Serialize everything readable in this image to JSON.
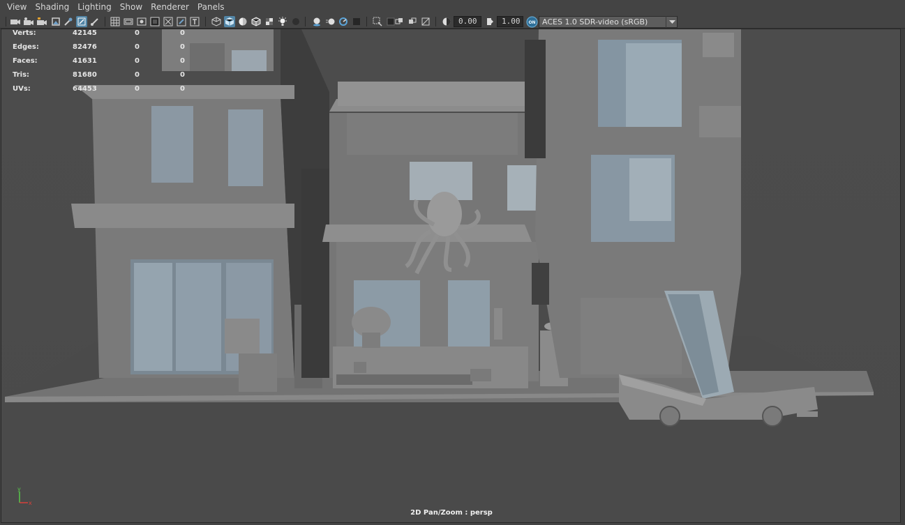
{
  "menu": {
    "view": "View",
    "shading": "Shading",
    "lighting": "Lighting",
    "show": "Show",
    "renderer": "Renderer",
    "panels": "Panels"
  },
  "toolbar": {
    "exposure_value": "0.00",
    "gamma_value": "1.00",
    "color_management_label": "ON",
    "view_transform": "ACES 1.0 SDR-video (sRGB)",
    "active_color": "#5285a6"
  },
  "hud": {
    "rows": [
      {
        "label": "Verts:",
        "v1": "42145",
        "v2": "0",
        "v3": "0"
      },
      {
        "label": "Edges:",
        "v1": "82476",
        "v2": "0",
        "v3": "0"
      },
      {
        "label": "Faces:",
        "v1": "41631",
        "v2": "0",
        "v3": "0"
      },
      {
        "label": "Tris:",
        "v1": "81680",
        "v2": "0",
        "v3": "0"
      },
      {
        "label": "UVs:",
        "v1": "64453",
        "v2": "0",
        "v3": "0"
      }
    ]
  },
  "viewport": {
    "camera_label": "2D Pan/Zoom : persp",
    "axis_x": "x",
    "axis_y": "y",
    "axis_x_color": "#d9403a",
    "axis_y_color": "#58c94a",
    "background_color": "#505050"
  }
}
